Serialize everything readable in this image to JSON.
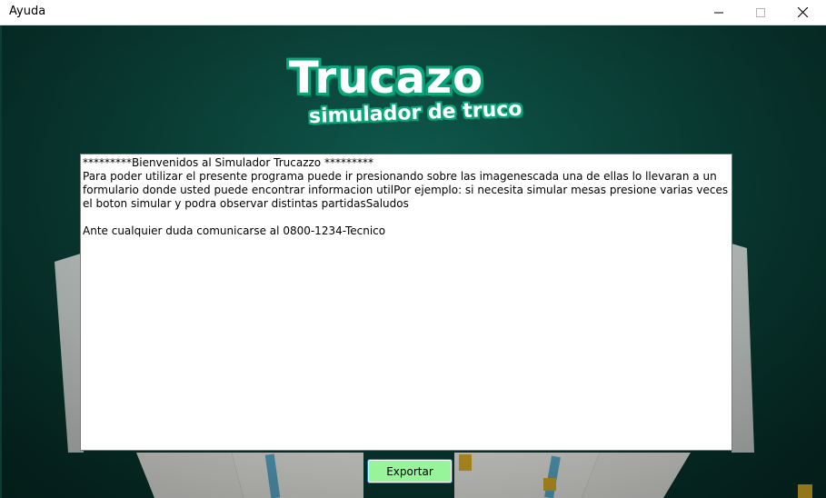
{
  "window": {
    "title": "Ayuda",
    "controls": {
      "minimize_icon": "minimize-icon",
      "maximize_icon": "maximize-icon",
      "close_icon": "close-icon"
    }
  },
  "logo": {
    "main_text": "Trucazo",
    "sub_text": "simulador de truco",
    "colors": {
      "fill": "#ffffff",
      "outline": "#0aa57a",
      "shadow": "#066b4f"
    }
  },
  "help": {
    "lines": [
      "*********Bienvenidos al Simulador Trucazzo *********",
      "Para poder utilizar el presente programa puede ir presionando sobre las imagenescada una de ellas lo llevaran a un formulario donde usted puede encontrar informacion utilPor ejemplo: si necesita simular mesas presione varias veces el boton simular y podra observar distintas partidasSaludos",
      "",
      "Ante cualquier duda comunicarse al 0800-1234-Tecnico"
    ]
  },
  "export_button": {
    "label": "Exportar",
    "color": "#98f49a"
  },
  "theme": {
    "background": "#0c4a40"
  }
}
